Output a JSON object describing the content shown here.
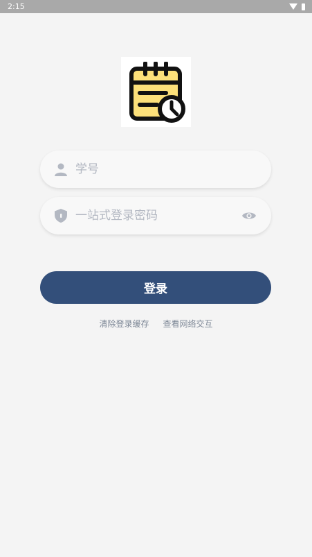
{
  "status_bar": {
    "time": "2:15"
  },
  "form": {
    "username_placeholder": "学号",
    "password_placeholder": "一站式登录密码",
    "login_label": "登录"
  },
  "links": {
    "clear_cache": "清除登录缓存",
    "view_network": "查看网络交互"
  },
  "colors": {
    "primary": "#334f7a",
    "background": "#f4f4f4",
    "icon_gray": "#b3b8c2",
    "logo_yellow": "#fce07a"
  }
}
